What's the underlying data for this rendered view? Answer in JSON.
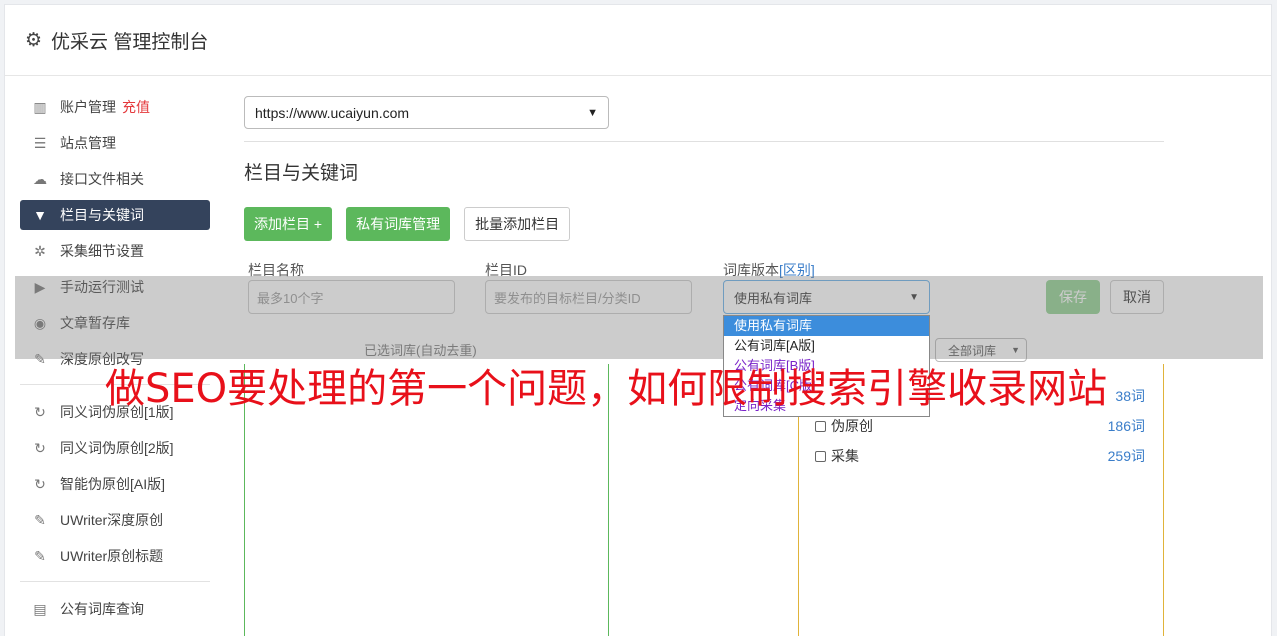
{
  "header": {
    "icon": "gear-icon",
    "title": "优采云 管理控制台"
  },
  "sidebar": {
    "items": [
      {
        "icon": "bar-chart-icon",
        "label": "账户管理",
        "badge": "充值"
      },
      {
        "icon": "server-icon",
        "label": "站点管理"
      },
      {
        "icon": "cloud-upload-icon",
        "label": "接口文件相关"
      },
      {
        "icon": "filter-icon",
        "label": "栏目与关键词",
        "active": true
      },
      {
        "icon": "cogs-icon",
        "label": "采集细节设置"
      },
      {
        "icon": "play-icon",
        "label": "手动运行测试"
      },
      {
        "icon": "database-icon",
        "label": "文章暂存库"
      },
      {
        "icon": "edit-icon",
        "label": "深度原创改写"
      }
    ],
    "items2": [
      {
        "icon": "refresh-icon",
        "label": "同义词伪原创[1版]"
      },
      {
        "icon": "refresh-icon",
        "label": "同义词伪原创[2版]"
      },
      {
        "icon": "refresh-icon",
        "label": "智能伪原创[AI版]"
      },
      {
        "icon": "edit-icon",
        "label": "UWriter深度原创"
      },
      {
        "icon": "edit-icon",
        "label": "UWriter原创标题"
      }
    ],
    "items3": [
      {
        "icon": "book-icon",
        "label": "公有词库查询"
      }
    ]
  },
  "main": {
    "site_select": "https://www.ucaiyun.com",
    "section_title": "栏目与关键词",
    "buttons": {
      "add_column": "添加栏目 +",
      "private_lib": "私有词库管理",
      "batch_add": "批量添加栏目"
    },
    "form": {
      "name_label": "栏目名称",
      "name_placeholder": "最多10个字",
      "id_label": "栏目ID",
      "id_placeholder": "要发布的目标栏目/分类ID",
      "version_label": "词库版本",
      "version_link": "[区别]",
      "version_value": "使用私有词库",
      "save": "保存",
      "cancel": "取消"
    },
    "dropdown_options": [
      "使用私有词库",
      "公有词库[A版]",
      "公有词库[B版]",
      "公有词库[C版]",
      "定向采集"
    ],
    "selected_title": "已选词库(自动去重)",
    "filter_select": "全部词库",
    "libraries": [
      {
        "name": "",
        "count": "38词"
      },
      {
        "name": "伪原创",
        "count": "186词"
      },
      {
        "name": "采集",
        "count": "259词"
      }
    ]
  },
  "banner": "做SEO要处理的第一个问题，如何限制搜索引擎收录网站"
}
